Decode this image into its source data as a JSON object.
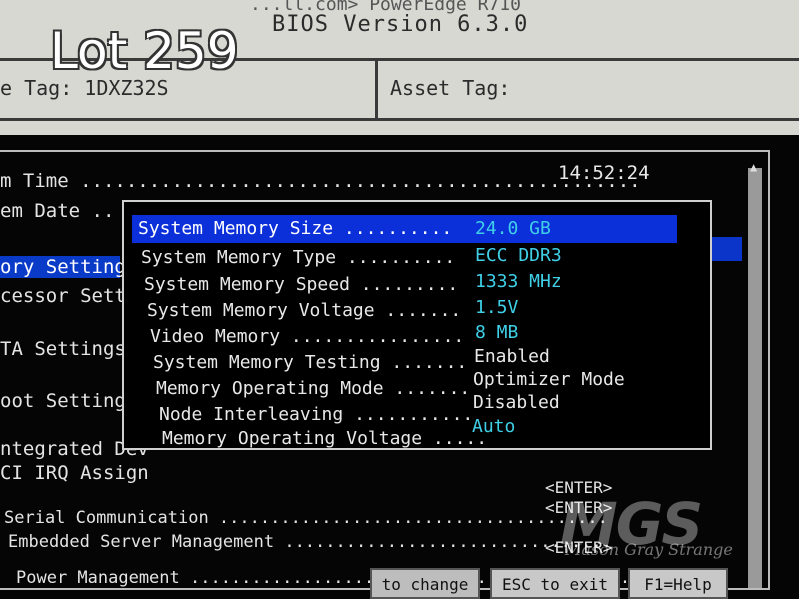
{
  "header": {
    "top_text": "...ll.com>   PowerEdge R710",
    "bios_version": "BIOS Version 6.3.0",
    "service_tag": "e Tag: 1DXZ32S",
    "asset_tag": "Asset Tag:"
  },
  "overlay": {
    "lot": "Lot 259"
  },
  "menu": {
    "rows": [
      {
        "label": "m Time .................................................",
        "selected": false
      },
      {
        "label": "em Date ..",
        "selected": false
      },
      {
        "label": "ory Setting",
        "selected": true
      },
      {
        "label": "cessor Sett",
        "selected": false
      },
      {
        "label": "TA Settings",
        "selected": false
      },
      {
        "label": "oot Settings",
        "selected": false
      },
      {
        "label": "ntegrated Dev",
        "selected": false
      },
      {
        "label": "CI IRQ Assign",
        "selected": false
      },
      {
        "label": "Serial Communication ......................................",
        "selected": false
      },
      {
        "label": "Embedded Server Management ................................",
        "selected": false
      },
      {
        "label": "Power Management ...........................................",
        "selected": false
      }
    ],
    "time_value": "14:52:24",
    "enter_labels": [
      "<ENTER>",
      "<ENTER>",
      "<ENTER>"
    ]
  },
  "popup": {
    "items": [
      {
        "label": "System Memory Size ..........",
        "value": "24.0 GB"
      },
      {
        "label": "System Memory Type ..........",
        "value": "ECC DDR3"
      },
      {
        "label": "System Memory Speed .........",
        "value": "1333 MHz"
      },
      {
        "label": "System Memory Voltage .......",
        "value": "1.5V"
      },
      {
        "label": "Video Memory ................",
        "value": "8 MB"
      },
      {
        "label": "System Memory Testing .......",
        "value": "Enabled"
      },
      {
        "label": "Memory Operating Mode .......",
        "value": "Optimizer Mode"
      },
      {
        "label": "Node Interleaving ...........",
        "value": "Disabled"
      },
      {
        "label": "Memory Operating Voltage .....",
        "value": "Auto"
      }
    ]
  },
  "footer": {
    "change_hint": "to change",
    "esc_label": "ESC to exit",
    "f1_label": "F1=Help"
  },
  "watermark": {
    "logo": "MGS",
    "name": "Mason Gray Strange"
  },
  "colors": {
    "selection_blue": "#0a3ac8",
    "value_cyan": "#3fd0e8"
  }
}
